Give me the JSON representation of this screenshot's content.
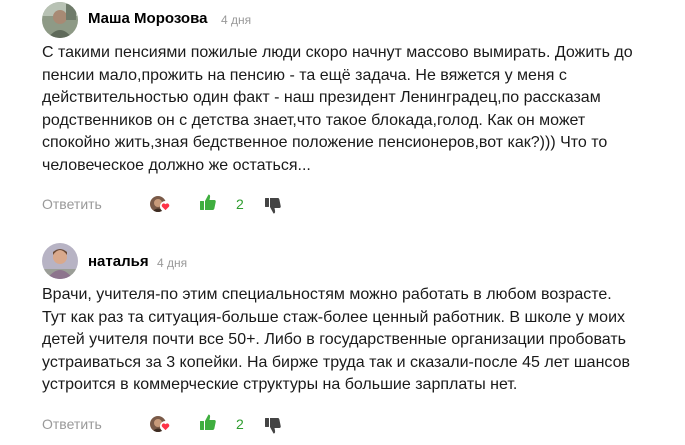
{
  "comments": [
    {
      "author": "Маша Морозова",
      "time": "4 дня",
      "avatar_icon": "user-photo-avatar",
      "lines": [
        "С такими пенсиями пожилые люди скоро начнут массово вымирать. Дожить до",
        "пенсии мало,прожить на пенсию - та ещё задача. Не вяжется у меня с",
        "действительностью один факт - наш президент Ленинградец,по рассказам",
        "родственников он с детства знает,что такое блокада,голод. Как он может",
        "спокойно жить,зная бедственное положение пенсионеров,вот как?))) Что то",
        "человеческое должно же остаться..."
      ],
      "reply_label": "Ответить",
      "likes": "2"
    },
    {
      "author": "наталья",
      "time": "4 дня",
      "avatar_icon": "user-photo-avatar",
      "lines": [
        "Врачи, учителя-по этим специальностям можно работать в любом возрасте.",
        "Тут как раз та ситуация-больше стаж-более ценный работник. В школе у моих",
        "детей учителя почти все 50+. Либо в государственные организации пробовать",
        "устраиваться за 3 копейки. На бирже труда так и сказали-после 45 лет шансов",
        "устроится в коммерческие структуры на большие зарплаты нет."
      ],
      "reply_label": "Ответить",
      "likes": "2"
    }
  ],
  "colors": {
    "like_green": "#3fae3f",
    "dislike_gray": "#444444",
    "muted_text": "#999999",
    "heart_red": "#ff3347"
  }
}
